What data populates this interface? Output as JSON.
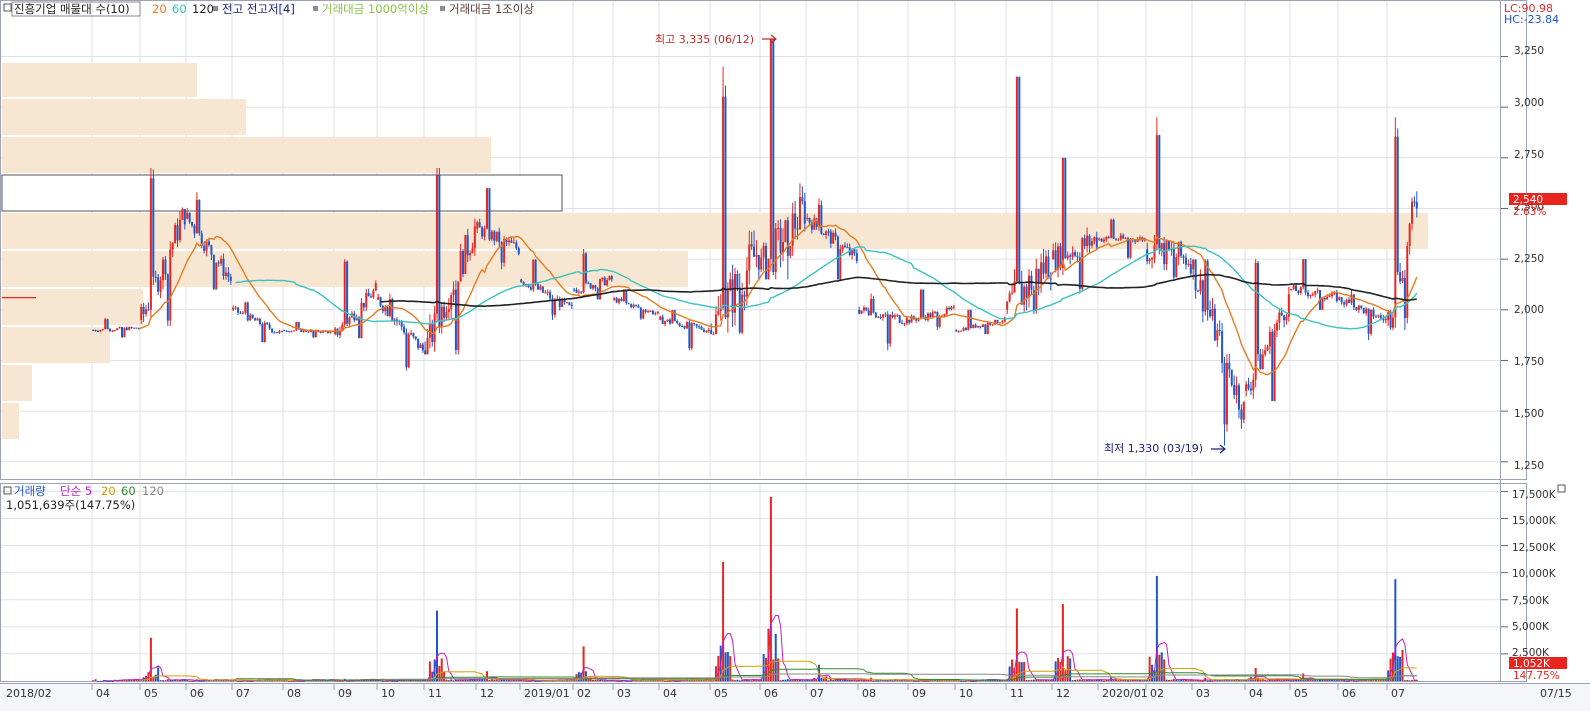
{
  "header": {
    "title": "진흥기업 매물대 수(10)",
    "ma_periods": [
      "20",
      "60",
      "120"
    ],
    "ma_colors": [
      "#e87b1e",
      "#3cc2c2",
      "#222222"
    ],
    "legend_items": [
      {
        "label": "전고 전고저[4]",
        "color": "#1a237e"
      },
      {
        "label": "거래대금 1000억이상",
        "color": "#8bc34a"
      },
      {
        "label": "거래대금 1조이상",
        "color": "#5d4037"
      }
    ],
    "lc": "LC:90.98",
    "hc": "HC:-23.84"
  },
  "price_panel": {
    "y_ticks": [
      "3,250",
      "3,000",
      "2,750",
      "2,500",
      "2,250",
      "2,000",
      "1,750",
      "1,500",
      "1,250"
    ],
    "current_price": "2,540",
    "current_pct": "2.63%",
    "high_label": "최고 3,335 (06/12)",
    "low_label": "최저 1,330 (03/19)",
    "up_color": "#e8251f",
    "down_color": "#1f56c9"
  },
  "volume_panel": {
    "legend_title": "거래량",
    "legend_ma": [
      {
        "label": "단순 5",
        "color": "#c020c0"
      },
      {
        "label": "20",
        "color": "#d4a000"
      },
      {
        "label": "60",
        "color": "#2e8b2e"
      },
      {
        "label": "120",
        "color": "#888888"
      }
    ],
    "current_text": "1,051,639주(147.75%)",
    "y_ticks": [
      "17,500K",
      "15,000K",
      "12,500K",
      "10,000K",
      "7,500K",
      "5,000K",
      "2,500K"
    ],
    "current_volume": "1,052K",
    "current_pct": "147.75%"
  },
  "x_axis": {
    "labels": [
      "2018/02",
      "04",
      "05",
      "06",
      "07",
      "08",
      "09",
      "10",
      "11",
      "12",
      "2019/01",
      "02",
      "03",
      "04",
      "05",
      "06",
      "07",
      "08",
      "09",
      "10",
      "11",
      "12",
      "2020/01",
      "02",
      "03",
      "04",
      "05",
      "06",
      "07"
    ],
    "end_label": "07/15"
  },
  "chart_data": {
    "type": "candlestick",
    "price_ylim": [
      1170,
      3430
    ],
    "volume_ylim": [
      0,
      18000
    ],
    "volume_unit": "K",
    "price_series": [
      {
        "x": "2018/02",
        "open": 2060,
        "high": 2070,
        "low": 2050,
        "close": 2060
      },
      {
        "x": "04",
        "open": 1900,
        "high": 1960,
        "low": 1860,
        "close": 1910
      },
      {
        "x": "05",
        "open": 1950,
        "high": 2700,
        "low": 1920,
        "close": 2480
      },
      {
        "x": "06",
        "open": 2450,
        "high": 2580,
        "low": 2100,
        "close": 2150
      },
      {
        "x": "07",
        "open": 2000,
        "high": 2040,
        "low": 1840,
        "close": 1880
      },
      {
        "x": "08",
        "open": 1900,
        "high": 1940,
        "low": 1860,
        "close": 1890
      },
      {
        "x": "09",
        "open": 1880,
        "high": 2250,
        "low": 1860,
        "close": 2100
      },
      {
        "x": "10",
        "open": 2050,
        "high": 2080,
        "low": 1700,
        "close": 1800
      },
      {
        "x": "11",
        "open": 1800,
        "high": 2700,
        "low": 1780,
        "close": 2400
      },
      {
        "x": "12",
        "open": 2400,
        "high": 2600,
        "low": 2200,
        "close": 2300
      },
      {
        "x": "2019/01",
        "open": 2150,
        "high": 2250,
        "low": 1950,
        "close": 2000
      },
      {
        "x": "02",
        "open": 2100,
        "high": 2300,
        "low": 2050,
        "close": 2150
      },
      {
        "x": "03",
        "open": 2050,
        "high": 2100,
        "low": 1950,
        "close": 1980
      },
      {
        "x": "04",
        "open": 1950,
        "high": 2000,
        "low": 1800,
        "close": 1900
      },
      {
        "x": "05",
        "open": 1900,
        "high": 3200,
        "low": 1880,
        "close": 2300
      },
      {
        "x": "06",
        "open": 2200,
        "high": 3335,
        "low": 2150,
        "close": 2500
      },
      {
        "x": "07",
        "open": 2450,
        "high": 2550,
        "low": 2150,
        "close": 2250
      },
      {
        "x": "08",
        "open": 2000,
        "high": 2080,
        "low": 1800,
        "close": 1950
      },
      {
        "x": "09",
        "open": 1950,
        "high": 2100,
        "low": 1900,
        "close": 2000
      },
      {
        "x": "10",
        "open": 1900,
        "high": 2000,
        "low": 1880,
        "close": 1950
      },
      {
        "x": "11",
        "open": 2000,
        "high": 3150,
        "low": 1980,
        "close": 2250
      },
      {
        "x": "12",
        "open": 2250,
        "high": 2750,
        "low": 2080,
        "close": 2350
      },
      {
        "x": "2020/01",
        "open": 2350,
        "high": 2450,
        "low": 2250,
        "close": 2350
      },
      {
        "x": "02",
        "open": 2300,
        "high": 2950,
        "low": 2150,
        "close": 2250
      },
      {
        "x": "03",
        "open": 2200,
        "high": 2250,
        "low": 1330,
        "close": 1500
      },
      {
        "x": "04",
        "open": 1600,
        "high": 2250,
        "low": 1550,
        "close": 2050
      },
      {
        "x": "05",
        "open": 2100,
        "high": 2250,
        "low": 2000,
        "close": 2060
      },
      {
        "x": "06",
        "open": 2050,
        "high": 2100,
        "low": 1850,
        "close": 1950
      },
      {
        "x": "07",
        "open": 1950,
        "high": 2950,
        "low": 1900,
        "close": 2540
      }
    ],
    "volume_series": [
      {
        "x": "04",
        "value": 50
      },
      {
        "x": "05",
        "value": 4000
      },
      {
        "x": "06",
        "value": 150
      },
      {
        "x": "07",
        "value": 80
      },
      {
        "x": "08",
        "value": 60
      },
      {
        "x": "09",
        "value": 200
      },
      {
        "x": "10",
        "value": 100
      },
      {
        "x": "11",
        "value": 6500
      },
      {
        "x": "12",
        "value": 900
      },
      {
        "x": "2019/01",
        "value": 120
      },
      {
        "x": "02",
        "value": 3200
      },
      {
        "x": "03",
        "value": 90
      },
      {
        "x": "04",
        "value": 80
      },
      {
        "x": "05",
        "value": 11000
      },
      {
        "x": "06",
        "value": 17000
      },
      {
        "x": "07",
        "value": 1500
      },
      {
        "x": "08",
        "value": 300
      },
      {
        "x": "09",
        "value": 120
      },
      {
        "x": "10",
        "value": 100
      },
      {
        "x": "11",
        "value": 6700
      },
      {
        "x": "12",
        "value": 7100
      },
      {
        "x": "2020/01",
        "value": 400
      },
      {
        "x": "02",
        "value": 9700
      },
      {
        "x": "03",
        "value": 300
      },
      {
        "x": "04",
        "value": 1200
      },
      {
        "x": "05",
        "value": 700
      },
      {
        "x": "06",
        "value": 200
      },
      {
        "x": "07",
        "value": 9400
      }
    ]
  }
}
